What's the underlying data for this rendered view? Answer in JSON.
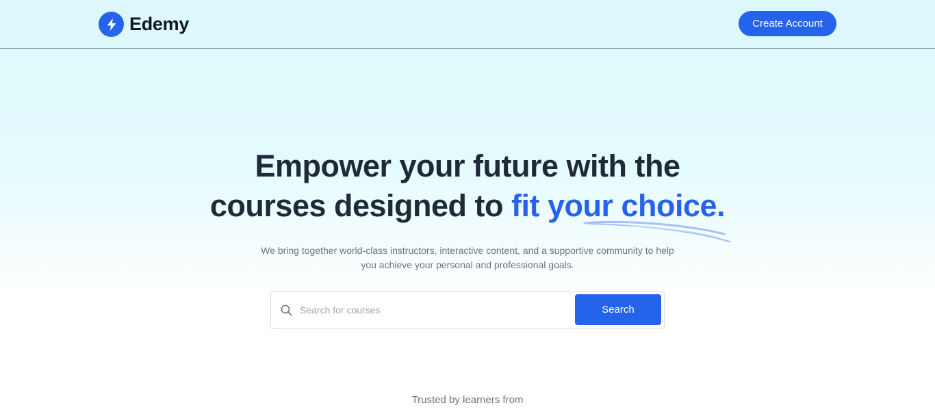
{
  "header": {
    "brand": "Edemy",
    "create_account_label": "Create Account"
  },
  "hero": {
    "title_line1": "Empower your future with the",
    "title_line2_prefix": "courses designed to ",
    "title_line2_highlight": "fit your choice.",
    "subtitle_line1": "We bring together world-class instructors, interactive content, and a supportive community to help",
    "subtitle_line2": "you achieve your personal and professional goals."
  },
  "search": {
    "placeholder": "Search for courses",
    "value": "",
    "button_label": "Search"
  },
  "trusted": {
    "label": "Trusted by learners from"
  },
  "colors": {
    "accent": "#2563eb",
    "heading": "#1f2937",
    "muted": "#6b7280"
  },
  "icons": {
    "logo": "lightning-bolt-icon",
    "search": "search-icon"
  }
}
